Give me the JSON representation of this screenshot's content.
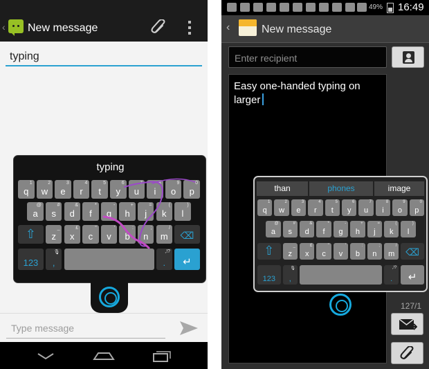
{
  "left_phone": {
    "header": {
      "title": "New message",
      "back_glyph": "‹"
    },
    "recipient": {
      "value": "typing"
    },
    "keyboard": {
      "suggestion": "typing",
      "rows": [
        [
          [
            "q",
            "1"
          ],
          [
            "w",
            "2"
          ],
          [
            "e",
            "3"
          ],
          [
            "r",
            "4"
          ],
          [
            "t",
            "5"
          ],
          [
            "y",
            "6"
          ],
          [
            "u",
            "7"
          ],
          [
            "i",
            "8"
          ],
          [
            "o",
            "9"
          ],
          [
            "p",
            "0"
          ]
        ],
        [
          [
            "a",
            "@"
          ],
          [
            "s",
            "#"
          ],
          [
            "d",
            "&"
          ],
          [
            "f",
            "*"
          ],
          [
            "g",
            "-"
          ],
          [
            "h",
            "+"
          ],
          [
            "j",
            "="
          ],
          [
            "k",
            "("
          ],
          [
            "l",
            ")"
          ]
        ],
        [
          [
            "z",
            "_"
          ],
          [
            "x",
            "£"
          ],
          [
            "c",
            "\""
          ],
          [
            "v",
            "'"
          ],
          [
            "b",
            ":"
          ],
          [
            "n",
            ";"
          ],
          [
            "m",
            "/"
          ]
        ]
      ],
      "shift_glyph": "⇧",
      "delete_glyph": "⌫",
      "symbols_label": "123",
      "comma_label": ",",
      "period_label": ".",
      "period_sub": ",!?",
      "enter_glyph": "↵",
      "mic_glyph": "🎙"
    },
    "message_input": {
      "placeholder": "Type message"
    }
  },
  "right_phone": {
    "status": {
      "battery": "49%",
      "clock": "16:49",
      "icons": [
        "plus-icon",
        "card-icon",
        "gmail-icon",
        "gmail-icon",
        "chat-icon",
        "facebook-icon",
        "linkedin-icon",
        "mute-icon",
        "alarm-icon",
        "wifi-icon",
        "signal-icon"
      ]
    },
    "header": {
      "title": "New message",
      "back_glyph": "‹"
    },
    "recipient": {
      "placeholder": "Enter recipient"
    },
    "compose": {
      "text": "Easy one-handed typing on larger"
    },
    "counter": "127/1",
    "keyboard": {
      "suggestions": [
        "than",
        "phones",
        "image"
      ],
      "rows": [
        [
          [
            "q",
            "1"
          ],
          [
            "w",
            "2"
          ],
          [
            "e",
            "3"
          ],
          [
            "r",
            "4"
          ],
          [
            "t",
            "5"
          ],
          [
            "y",
            "6"
          ],
          [
            "u",
            "7"
          ],
          [
            "i",
            "8"
          ],
          [
            "o",
            "9"
          ],
          [
            "p",
            "0"
          ]
        ],
        [
          [
            "a",
            "@"
          ],
          [
            "s",
            "#"
          ],
          [
            "d",
            "&"
          ],
          [
            "f",
            "*"
          ],
          [
            "g",
            "-"
          ],
          [
            "h",
            "+"
          ],
          [
            "j",
            "="
          ],
          [
            "k",
            "("
          ],
          [
            "l",
            ")"
          ]
        ],
        [
          [
            "z",
            "_"
          ],
          [
            "x",
            "£"
          ],
          [
            "c",
            "\""
          ],
          [
            "v",
            "'"
          ],
          [
            "b",
            ":"
          ],
          [
            "n",
            ";"
          ],
          [
            "m",
            "/"
          ]
        ]
      ],
      "shift_glyph": "⇧",
      "delete_glyph": "⌫",
      "symbols_label": "123",
      "comma_label": ",",
      "period_label": ".",
      "period_sub": ",!?",
      "enter_glyph": "↵",
      "mic_glyph": "🎙"
    }
  },
  "colors": {
    "accent_blue": "#2aa1d1",
    "swipe_trail": "#9b49c9",
    "swipe_trail_alt": "#c24bc4"
  }
}
